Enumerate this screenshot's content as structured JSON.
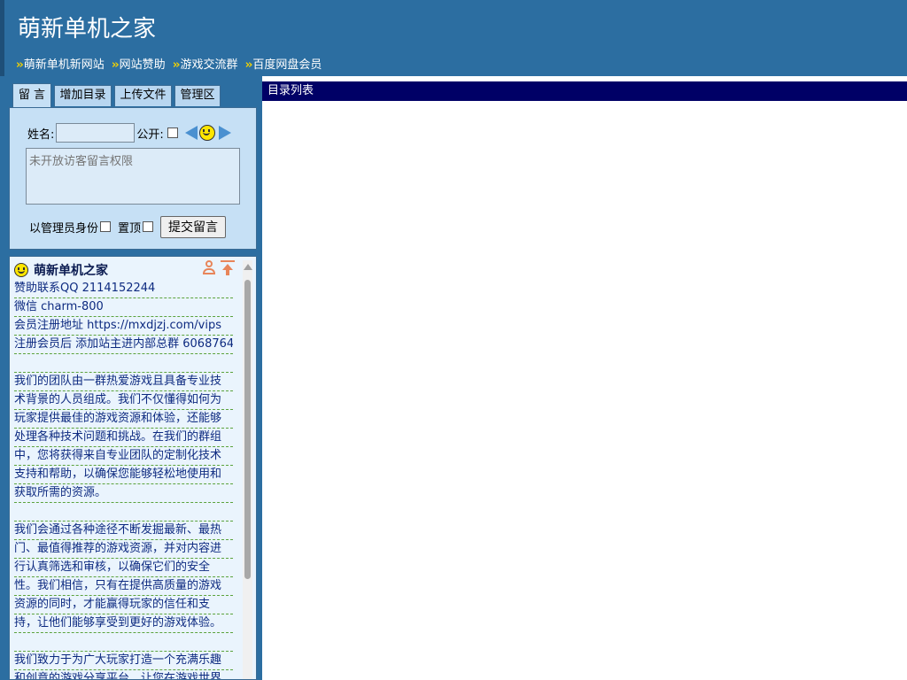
{
  "header": {
    "site_title": "萌新单机之家",
    "nav": [
      {
        "arrows": "››",
        "label": "萌新单机新网站"
      },
      {
        "arrows": "››",
        "label": "网站赞助"
      },
      {
        "arrows": "››",
        "label": "游戏交流群"
      },
      {
        "arrows": "››",
        "label": "百度网盘会员"
      }
    ]
  },
  "tabs": [
    {
      "label": "留 言",
      "active": true
    },
    {
      "label": "增加目录",
      "active": false
    },
    {
      "label": "上传文件",
      "active": false
    },
    {
      "label": "管理区",
      "active": false
    }
  ],
  "message_form": {
    "name_label": "姓名:",
    "name_value": "",
    "public_label": "公开:",
    "textarea_placeholder": "未开放访客留言权限",
    "admin_label": "以管理员身份",
    "pin_label": "置顶",
    "submit_label": "提交留言"
  },
  "post": {
    "author": "萌新单机之家",
    "lines": [
      "赞助联系QQ 2114152244",
      "微信 charm-800",
      "会员注册地址 https://mxdjzj.com/vips",
      "注册会员后 添加站主进内部总群 6068764",
      "",
      "我们的团队由一群热爱游戏且具备专业技",
      "术背景的人员组成。我们不仅懂得如何为",
      "玩家提供最佳的游戏资源和体验，还能够",
      "处理各种技术问题和挑战。在我们的群组",
      "中，您将获得来自专业团队的定制化技术",
      "支持和帮助，以确保您能够轻松地使用和",
      "获取所需的资源。",
      "",
      "我们会通过各种途径不断发掘最新、最热",
      "门、最值得推荐的游戏资源，并对内容进",
      "行认真筛选和审核，以确保它们的安全",
      "性。我们相信，只有在提供高质量的游戏",
      "资源的同时，才能赢得玩家的信任和支",
      "持，让他们能够享受到更好的游戏体验。",
      "",
      "我们致力于为广大玩家打造一个充满乐趣",
      "和创意的游戏分享平台，让您在游戏世界"
    ]
  },
  "directory": {
    "header": "目录列表"
  },
  "colors": {
    "header_bg": "#2c6ea1",
    "panel_bg": "#c6e0f5",
    "dir_header_bg": "#000066",
    "nav_arrow": "#f2d200"
  }
}
